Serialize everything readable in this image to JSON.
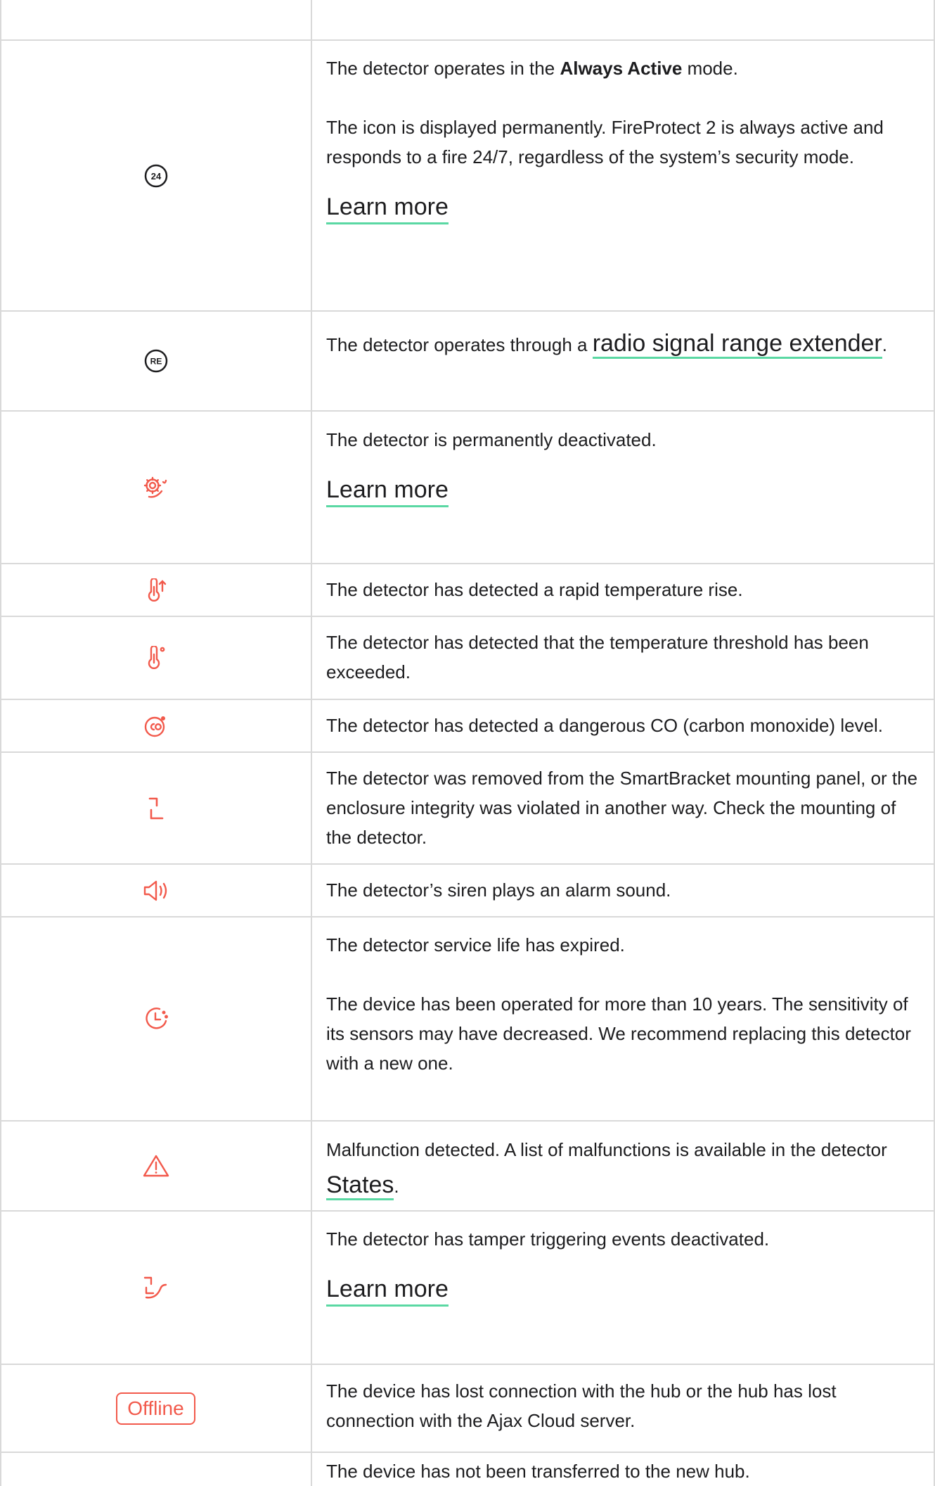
{
  "colors": {
    "icon_red": "#f2594b",
    "icon_dark": "#1d1d1f",
    "link_underline": "#5ad8a3",
    "border": "#d9d9d9"
  },
  "rows": [
    {
      "icon": "24-hour-icon",
      "text": [
        "The detector operates in the ",
        "Always Active",
        " mode."
      ],
      "text2": "The icon is displayed permanently. FireProtect 2 is always active and responds to a fire 24/7, regardless of the system’s security mode.",
      "link": "Learn more"
    },
    {
      "icon": "range-extender-icon",
      "text": "The detector operates through a ",
      "link": "radio signal range extender",
      "suffix": "."
    },
    {
      "icon": "gear-deactivated-icon",
      "text": "The detector is permanently deactivated.",
      "link": "Learn more"
    },
    {
      "icon": "thermometer-rise-icon",
      "text": "The detector has detected a rapid temperature rise."
    },
    {
      "icon": "thermometer-threshold-icon",
      "text": "The detector has detected that the temperature threshold has been exceeded."
    },
    {
      "icon": "co-icon",
      "text": "The detector has detected a dangerous CO (carbon monoxide) level."
    },
    {
      "icon": "tamper-icon",
      "text": "The detector was removed from the SmartBracket mounting panel, or the enclosure integrity was violated in another way. Check the mounting of the detector."
    },
    {
      "icon": "siren-icon",
      "text": "The detector’s siren plays an alarm sound."
    },
    {
      "icon": "service-life-icon",
      "text": "The detector service life has expired.",
      "text2": "The device has been operated for more than 10 years. The sensitivity of its sensors may have decreased. We recommend replacing this detector with a new one."
    },
    {
      "icon": "warning-icon",
      "text": "Malfunction detected. A list of malfunctions is available in the detector ",
      "link": "States",
      "suffix": "."
    },
    {
      "icon": "tamper-deactivated-icon",
      "text": "The detector has tamper triggering events deactivated.",
      "link": "Learn more"
    },
    {
      "icon": "offline-badge",
      "badge": "Offline",
      "text": "The device has lost connection with the hub or the hub has lost connection with the Ajax Cloud server."
    },
    {
      "icon": "none",
      "text": "The device has not been transferred to the new hub."
    }
  ]
}
